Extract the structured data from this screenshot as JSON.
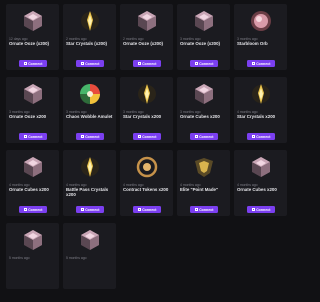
{
  "button_label": "Connect",
  "cards": [
    {
      "time": "12 days ago",
      "title": "Ornate Ooze (x200)",
      "icon": "ornate-cube-icon"
    },
    {
      "time": "2 months ago",
      "title": "Star Crystals (x200)",
      "icon": "star-crystal-icon"
    },
    {
      "time": "2 months ago",
      "title": "Ornate Ooze (x200)",
      "icon": "ornate-cube-icon"
    },
    {
      "time": "3 months ago",
      "title": "Ornate Ooze (x200)",
      "icon": "ornate-cube-icon"
    },
    {
      "time": "3 months ago",
      "title": "Starbloom Orb",
      "icon": "starbloom-orb-icon"
    },
    {
      "time": "3 months ago",
      "title": "Ornate Ooze x200",
      "icon": "ornate-cube-icon"
    },
    {
      "time": "3 months ago",
      "title": "Chaos Wobble Amulet",
      "icon": "chaos-orb-icon"
    },
    {
      "time": "3 months ago",
      "title": "Star Crystals x200",
      "icon": "star-crystal-icon"
    },
    {
      "time": "3 months ago",
      "title": "Ornate Cubes x200",
      "icon": "ornate-cube-icon"
    },
    {
      "time": "4 months ago",
      "title": "Star Crystals x200",
      "icon": "star-crystal-icon"
    },
    {
      "time": "4 months ago",
      "title": "Ornate Cubes x200",
      "icon": "ornate-cube-icon"
    },
    {
      "time": "4 months ago",
      "title": "Battle Pass Crystals x200",
      "icon": "star-crystal-icon"
    },
    {
      "time": "4 months ago",
      "title": "Contract Tokens x200",
      "icon": "contract-token-icon"
    },
    {
      "time": "4 months ago",
      "title": "Elite \"Point Made\"",
      "icon": "elite-helmet-icon"
    },
    {
      "time": "4 months ago",
      "title": "Ornate Cubes x200",
      "icon": "ornate-cube-icon"
    },
    {
      "time": "5 months ago",
      "title": "",
      "icon": "ornate-cube-icon"
    },
    {
      "time": "5 months ago",
      "title": "",
      "icon": "ornate-cube-icon"
    }
  ]
}
